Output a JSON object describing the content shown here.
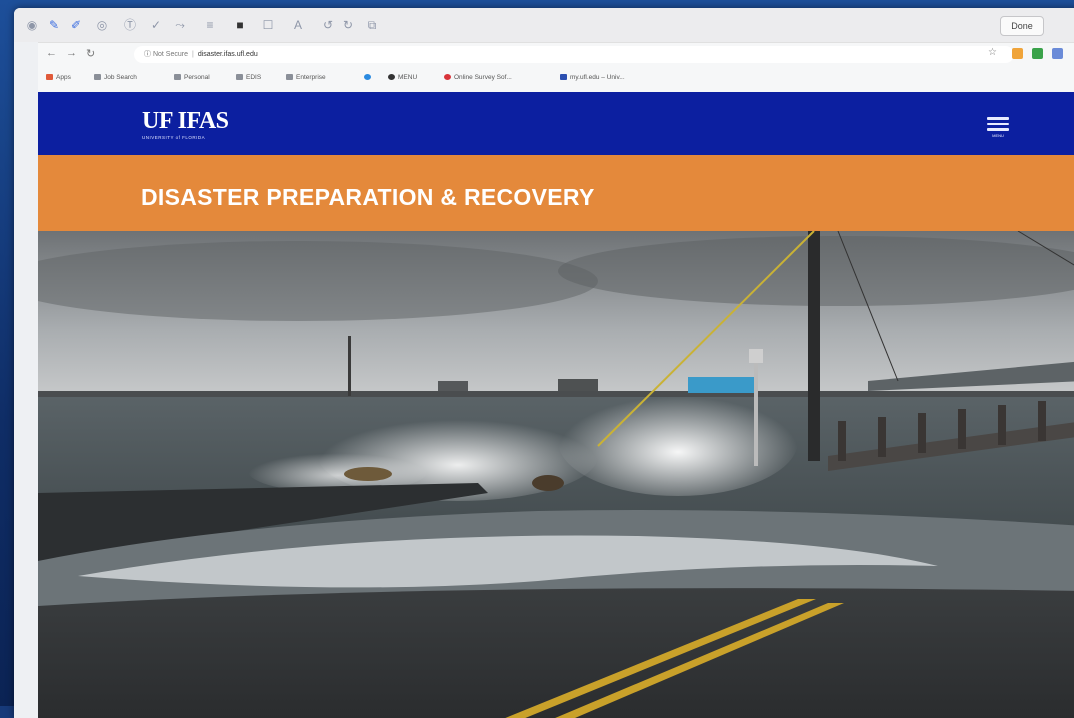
{
  "markup_toolbar": {
    "done_label": "Done"
  },
  "browser": {
    "security_label": "Not Secure",
    "url": "disaster.ifas.ufl.edu"
  },
  "bookmarks": [
    {
      "label": "Apps",
      "icon": "apps-grid-icon"
    },
    {
      "label": "Job Search",
      "icon": "folder-icon"
    },
    {
      "label": "Personal",
      "icon": "folder-icon"
    },
    {
      "label": "EDIS",
      "icon": "folder-icon"
    },
    {
      "label": "Enterprise",
      "icon": "folder-icon"
    },
    {
      "label": "",
      "icon": "globe-icon"
    },
    {
      "label": "MENU",
      "icon": "site-icon"
    },
    {
      "label": "Online Survey Sof...",
      "icon": "qualtrics-icon"
    },
    {
      "label": "my.ufl.edu – Univ...",
      "icon": "uf-icon"
    }
  ],
  "site": {
    "logo_text": "UF IFAS",
    "logo_subtext": "UNIVERSITY of FLORIDA",
    "menu_label": "MENU",
    "page_title": "DISASTER PREPARATION & RECOVERY",
    "hero_image": "storm-surge-flooded-road-photo"
  },
  "colors": {
    "header_blue": "#0c1fa0",
    "title_band_orange": "#e4893b"
  }
}
